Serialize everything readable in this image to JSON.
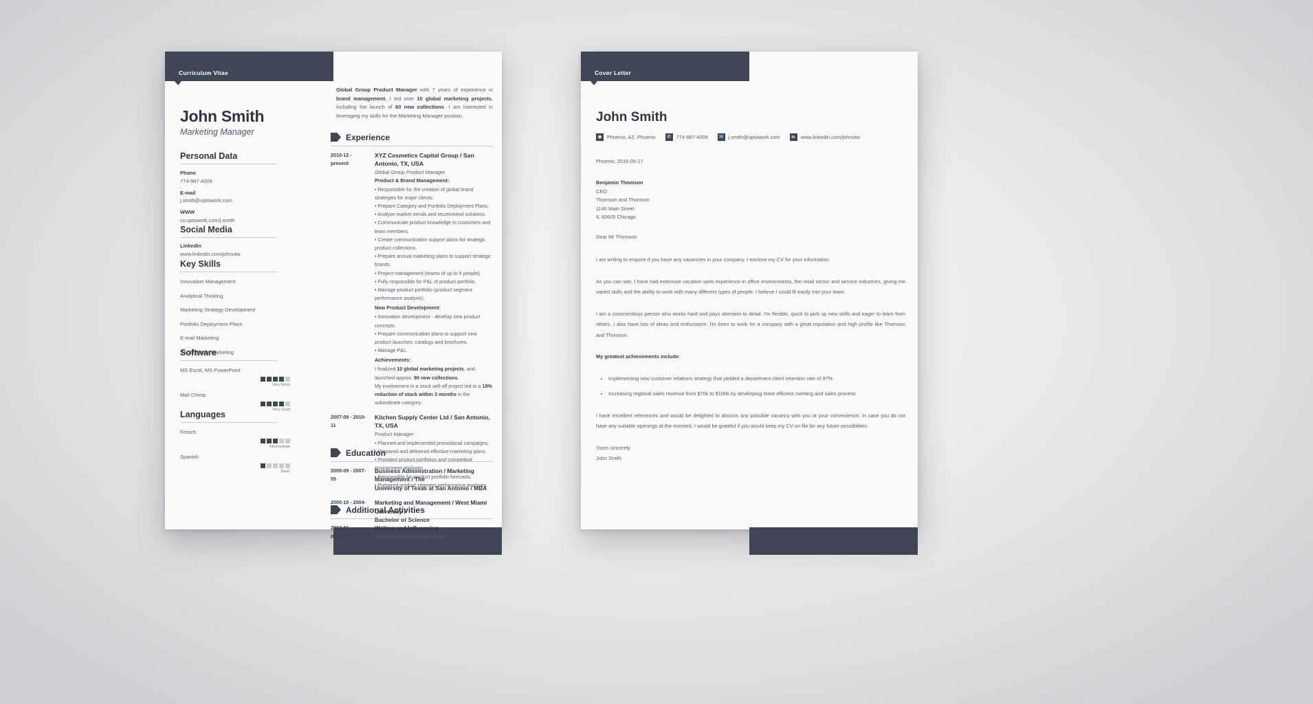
{
  "cv": {
    "banner_label": "Curriculum Vitae",
    "name": "John Smith",
    "job_title": "Marketing Manager",
    "summary": {
      "b1": "Global Group Product Manager",
      "t1": " with 7 years of experience in ",
      "b2": "brand management.",
      "t2": " I led over ",
      "b3": "10 global marketing projects",
      "t3": ", including the launch of ",
      "b4": "60 new collections",
      "t4": ". I am interested in leveraging my skills for the Marketing Manager position."
    },
    "personal_data": {
      "heading": "Personal Data",
      "phone_label": "Phone",
      "phone_value": "774-987-4009",
      "email_label": "E-mail",
      "email_value": "j.smith@uptowork.com",
      "www_label": "WWW",
      "www_value": "cv.uptowork.com/j.smith"
    },
    "social_media": {
      "heading": "Social Media",
      "linkedin_label": "LinkedIn",
      "linkedin_value": "www.linkedin.com/johnutw"
    },
    "key_skills": {
      "heading": "Key Skills",
      "items": [
        "Innovation Management",
        "Analytical Thinking",
        "Marketing Strategy Development",
        "Portfolio Deployment Plans",
        "E-mail Marketing",
        "Social Media Marketing"
      ]
    },
    "software": {
      "heading": "Software",
      "items": [
        {
          "name": "MS Excel, MS PowerPoint",
          "filled": 4,
          "total": 5,
          "caption": "Very Good"
        },
        {
          "name": "Mail Chimp",
          "filled": 4,
          "total": 5,
          "caption": "Very Good"
        }
      ]
    },
    "languages": {
      "heading": "Languages",
      "items": [
        {
          "name": "French",
          "filled": 3,
          "total": 5,
          "caption": "Intermediate"
        },
        {
          "name": "Spanish",
          "filled": 1,
          "total": 5,
          "caption": "Basic"
        }
      ]
    },
    "experience": {
      "heading": "Experience",
      "jobs": [
        {
          "dates": "2010-12 - present",
          "title": "XYZ Cosmetics Capital Group / San Antonio, TX, USA",
          "role": "Global Group Product Manager",
          "group1_title": "Product & Brand Management:",
          "group1_bullets": [
            "• Responsible for the creation of global brand strategies for major clients.",
            "• Prepare Category and Portfolio Deployment Plans.",
            "• Analyze market trends and recommend solutions.",
            "• Communicate product knowledge to customers and team members.",
            "• Create communication support plans for strategic product collections.",
            "• Prepare annual marketing plans to support strategic brands.",
            "• Project management (teams of up to 5 people).",
            "• Fully responsible for P&L of product portfolio.",
            "• Manage product portfolio (product segment performance analysis)."
          ],
          "group2_title": "New Product Development:",
          "group2_bullets": [
            "• Innovation development - develop new product concepts.",
            "• Prepare communication plans to support new product launches: catalogs and brochures.",
            "• Manage P&L."
          ],
          "ach_title": "Achievements:",
          "ach_1_a": "I finalized ",
          "ach_1_b": "10 global marketing projects",
          "ach_1_c": ", and launched approx. ",
          "ach_1_d": "90 new collections.",
          "ach_2_a": "My involvement in a stock sell-off project led to a ",
          "ach_2_b": "19% reduction of stock within 3 months",
          "ach_2_c": " in the subordinate category."
        },
        {
          "dates": "2007-09 - 2010-11",
          "title": "Kitchen Supply Center Ltd / San Antonio, TX, USA",
          "role": "Product Manager",
          "bullets": [
            "• Planned and implemented promotional campaigns.",
            "• Prepared and delivered effective marketing plans.",
            "• Provided product portfolios and competitive environment analyses.",
            "• Responsible for product portfolio forecasts.",
            "• Prepared product segment performance analyses."
          ]
        }
      ]
    },
    "education": {
      "heading": "Education",
      "items": [
        {
          "dates": "2005-09 - 2007-05",
          "line1": "Business Administration / Marketing Management / The",
          "line2": "University of Texas at San Antonio / MBA"
        },
        {
          "dates": "2000-10 - 2004-05",
          "line1": "Marketing and Management / West Miami University /",
          "line2": "Bachelor of Science"
        }
      ]
    },
    "additional": {
      "heading": "Additional Activities",
      "items": [
        {
          "dates": "2012-01 - present",
          "title": "Writing and Influencing",
          "sub": "www.mymarketingcampaings.me"
        }
      ]
    }
  },
  "cover_letter": {
    "banner_label": "Cover Letter",
    "name": "John Smith",
    "contacts": [
      {
        "icon": "location-icon",
        "glyph": "◉",
        "text": "Phoenix, AZ, Phoenix"
      },
      {
        "icon": "phone-icon",
        "glyph": "✆",
        "text": "774-987-4009"
      },
      {
        "icon": "email-icon",
        "glyph": "✉",
        "text": "j.smith@uptowork.com"
      },
      {
        "icon": "linkedin-icon",
        "glyph": "in",
        "text": "www.linkedin.com/johnutw"
      }
    ],
    "date_line": "Phoenix, 2016-05-17",
    "recipient": {
      "name": "Benjamin Thomson",
      "title": "CEO",
      "company": "Thomson and Thomson",
      "street": "1140 Main Street",
      "city": "IL 60605 Chicago"
    },
    "salutation": "Dear Mr Thomson",
    "paragraphs": [
      "I am writing to enquire if you have any vacancies in your company. I enclose my CV for your information.",
      "As you can see, I have had extensive vacation work experience in office environments, the retail sector and service industries, giving me varied skills and the ability to work with many different types of people. I believe I could fit easily into your team.",
      "I am a conscientious person who works hard and pays attention to detail. I'm flexible, quick to pick up new skills and eager to learn from others. I also have lots of ideas and enthusiasm. I'm keen to work for a company with a great reputation and high profile like Thomson and Thomson."
    ],
    "achievements_heading": "My greatest achievements include:",
    "achievements": [
      "Implementing new customer relations strategy that yielded a department client retention rate of 97%",
      "Increasing regional sales revenue from $70k to $100k by developing more efficient meeting and sales process"
    ],
    "closing_paragraph": "I have excellent references and would be delighted to discuss any possible vacancy with you at your convenience. In case you do not have any suitable openings at the moment, I would be grateful if you would keep my CV on file for any future possibilities.",
    "sign_off": "Yours sincerely",
    "signature": "John Smith"
  }
}
